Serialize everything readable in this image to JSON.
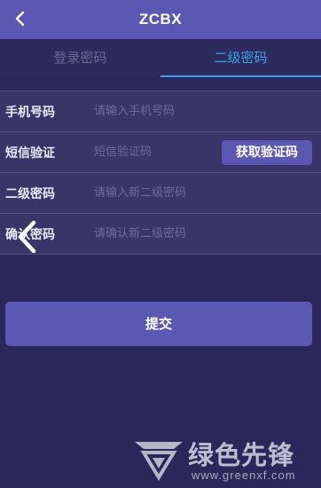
{
  "header": {
    "title": "ZCBX",
    "back_icon": "chevron-left-icon"
  },
  "tabs": [
    {
      "label": "登录密码",
      "active": false
    },
    {
      "label": "二级密码",
      "active": true
    }
  ],
  "form": {
    "phone": {
      "label": "手机号码",
      "placeholder": "请输入手机号码",
      "value": ""
    },
    "sms": {
      "label": "短信验证",
      "placeholder": "短信验证码",
      "value": "",
      "button": "获取验证码"
    },
    "new_password": {
      "label": "二级密码",
      "placeholder": "请输入新二级密码",
      "value": ""
    },
    "confirm_password": {
      "label": "确认密码",
      "placeholder": "请确认新二级密码",
      "value": ""
    }
  },
  "submit_label": "提交",
  "overlay_icon": "chevron-left-icon",
  "watermark": {
    "logo_icon": "greenxf-logo-icon",
    "text": "绿色先锋",
    "url": "www.greenxf.com"
  },
  "colors": {
    "header_bg": "#5b58b3",
    "page_bg": "#2a285a",
    "form_bg": "#383668",
    "accent": "#3ba2e8",
    "button_bg": "#5b58b3"
  }
}
